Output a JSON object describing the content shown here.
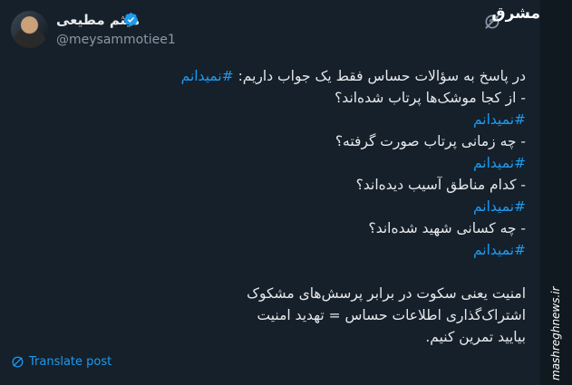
{
  "author": {
    "display_name": "میثم مطیعی",
    "handle": "@meysammotiee1",
    "verified": true,
    "avatar_icon": "avatar-photo"
  },
  "tweet": {
    "lines": [
      {
        "text": "در پاسخ به سؤالات حساس فقط یک جواب داریم: ",
        "hashtag": "#نمیدانم"
      },
      {
        "text": "- از کجا موشک‌ها پرتاب شده‌اند؟",
        "hashtag": ""
      },
      {
        "text": "",
        "hashtag": "#نمیدانم"
      },
      {
        "text": "- چه زمانی پرتاب صورت گرفته؟",
        "hashtag": ""
      },
      {
        "text": "",
        "hashtag": "#نمیدانم "
      },
      {
        "text": "- کدام مناطق آسیب دیده‌اند؟",
        "hashtag": ""
      },
      {
        "text": "",
        "hashtag": "#نمیدانم"
      },
      {
        "text": "- چه کسانی شهید شده‌اند؟",
        "hashtag": ""
      },
      {
        "text": "",
        "hashtag": "#نمیدانم"
      },
      {
        "text": "",
        "hashtag": ""
      },
      {
        "text": "امنیت یعنی سکوت در برابر پرسش‌های مشکوک",
        "hashtag": ""
      },
      {
        "text": "اشتراک‌گذاری اطلاعات حساس = تهدید امنیت",
        "hashtag": ""
      },
      {
        "text": "بیایید تمرین کنیم.",
        "hashtag": ""
      }
    ]
  },
  "actions": {
    "translate_label": "Translate post"
  },
  "branding": {
    "logo_text": "مشرق",
    "site_url": "mashreghnews.ir"
  },
  "colors": {
    "background": "#15202b",
    "text": "#e7e9ea",
    "link": "#1d9bf0",
    "muted": "#8b98a5",
    "verified": "#1d9bf0"
  }
}
